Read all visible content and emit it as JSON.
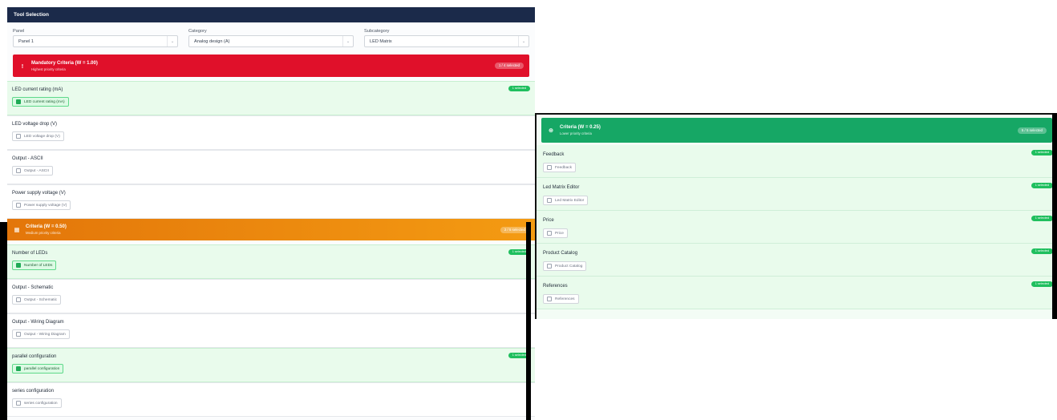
{
  "header": {
    "title": "Tool Selection"
  },
  "selectors": [
    {
      "label": "Panel",
      "value": "Panel 1"
    },
    {
      "label": "Category",
      "value": "Analog design (A)"
    },
    {
      "label": "Subcategory",
      "value": "LED Matrix"
    }
  ],
  "mandatory": {
    "title": "Mandatory Criteria (W = 1.00)",
    "subtitle": "Highest priority criteria",
    "badge": "1 / 4 selected",
    "color": "#e0102a",
    "items": [
      {
        "name": "LED current rating (mA)",
        "chip": "LED current rating (mA)",
        "selected": true,
        "badge": "1 selected"
      },
      {
        "name": "LED voltage drop (V)",
        "chip": "LED voltage drop (V)",
        "selected": false
      },
      {
        "name": "Output - ASCII",
        "chip": "Output - ASCII",
        "selected": false
      },
      {
        "name": "Power supply voltage (V)",
        "chip": "Power supply voltage (V)",
        "selected": false
      }
    ]
  },
  "medium": {
    "title": "Criteria (W = 0.50)",
    "subtitle": "Medium priority criteria",
    "badge": "2 / 5 selected",
    "color": "#f08a0c",
    "items": [
      {
        "name": "Number of LEDs",
        "chip": "Number of LEDs",
        "selected": true,
        "badge": "1 selected"
      },
      {
        "name": "Output - Schematic",
        "chip": "Output - Schematic",
        "selected": false
      },
      {
        "name": "Output - Wiring Diagram",
        "chip": "Output - Wiring Diagram",
        "selected": false
      },
      {
        "name": "parallel configuration",
        "chip": "parallel configuration",
        "selected": true,
        "badge": "1 selected"
      },
      {
        "name": "series configuration",
        "chip": "series configuration",
        "selected": false
      }
    ]
  },
  "lower": {
    "title": "Criteria (W = 0.25)",
    "subtitle": "Lower priority criteria",
    "badge": "5 / 5 selected",
    "color": "#16a765",
    "items": [
      {
        "name": "Feedback",
        "chip": "Feedback",
        "selected": true,
        "badge": "1 selected"
      },
      {
        "name": "Led Matrix Editor",
        "chip": "Led Matrix Editor",
        "selected": true,
        "badge": "1 selected"
      },
      {
        "name": "Price",
        "chip": "Price",
        "selected": true,
        "badge": "1 selected"
      },
      {
        "name": "Product Catalog",
        "chip": "Product Catalog",
        "selected": true,
        "badge": "1 selected"
      },
      {
        "name": "References",
        "chip": "References",
        "selected": true,
        "badge": "1 selected"
      }
    ]
  },
  "icons": {
    "select_chevron": "chevron-down-icon",
    "mandatory": "exclamation-icon",
    "medium": "grid-icon",
    "lower": "target-icon",
    "checkbox": "checkbox-icon"
  }
}
